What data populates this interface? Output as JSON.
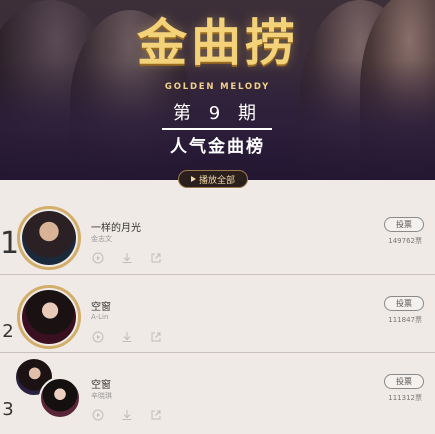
{
  "banner": {
    "logo_text": "金曲捞",
    "logo_sub": "GOLDEN MELODY",
    "issue": "第 9 期",
    "subtitle": "人气金曲榜",
    "play_all_label": "播放全部"
  },
  "songs": [
    {
      "rank": "1",
      "title": "一样的月光",
      "singer": "金志文",
      "vote_label": "投票",
      "votes": "149762票"
    },
    {
      "rank": "2",
      "title": "空窗",
      "singer": "A-Lin",
      "vote_label": "投票",
      "votes": "111847票"
    },
    {
      "rank": "3",
      "title": "空窗",
      "singer": "辛晓琪",
      "vote_label": "投票",
      "votes": "111312票"
    }
  ],
  "colors": {
    "gold": "#d3ad6a",
    "background": "#efeae6",
    "banner": "#2d2034"
  },
  "icons": [
    "play-icon",
    "download-icon",
    "share-icon"
  ]
}
